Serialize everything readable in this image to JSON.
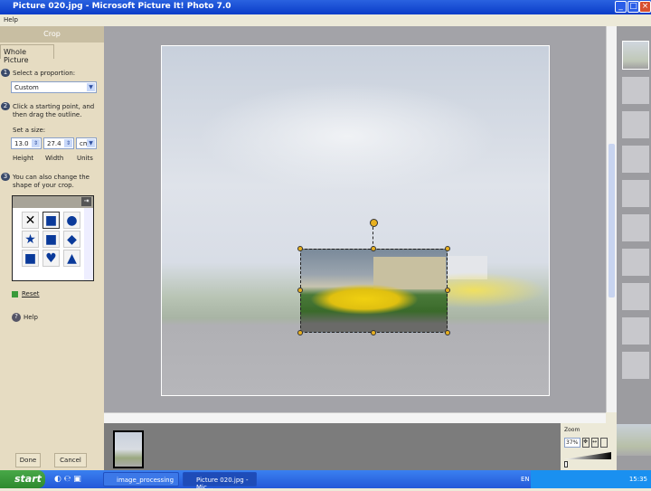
{
  "window": {
    "title": "Picture 020.jpg - Microsoft Picture It! Photo 7.0",
    "menu": [
      "Help"
    ]
  },
  "panel": {
    "header": "Crop",
    "tab": "Whole Picture",
    "step1": {
      "num": "1",
      "label": "Select a proportion:",
      "value": "Custom"
    },
    "step2": {
      "num": "2",
      "label": "Click a starting point, and then drag the outline.",
      "set_size": "Set a size:",
      "height": "13.0",
      "width": "27.4",
      "units": "cm",
      "height_label": "Height",
      "width_label": "Width",
      "units_label": "Units"
    },
    "step3": {
      "num": "3",
      "label": "You can also change the shape of your crop."
    },
    "shapes": [
      "no-shape",
      "rectangle",
      "circle",
      "star",
      "rounded-square",
      "diamond",
      "shield",
      "heart",
      "arch"
    ],
    "reset": "Reset",
    "help": "Help",
    "done": "Done",
    "cancel": "Cancel"
  },
  "zoom": {
    "label": "Zoom",
    "value": "37%"
  },
  "taskbar": {
    "start": "start",
    "tasks": [
      "image_processing",
      "Picture 020.jpg - Mic..."
    ],
    "lang": "EN",
    "clock": "15:35"
  }
}
